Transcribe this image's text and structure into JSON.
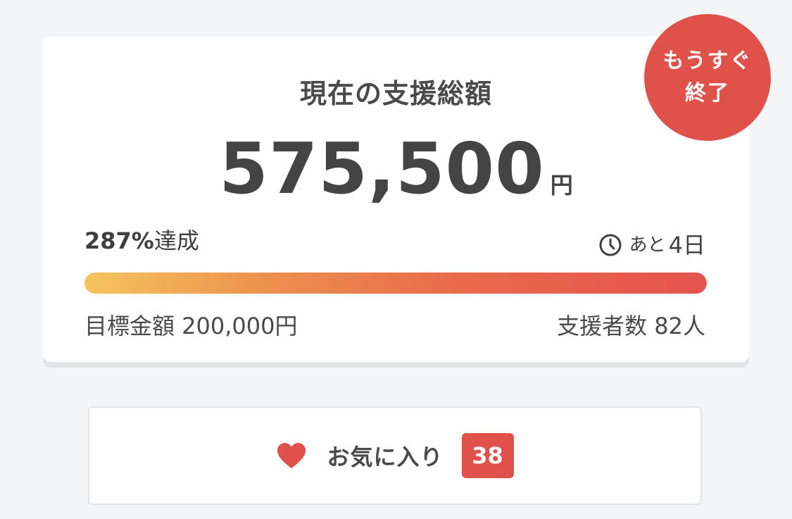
{
  "card": {
    "title": "現在の支援総額",
    "amount": "575,500",
    "amount_unit": "円",
    "achievement_percent": "287%",
    "achievement_suffix": "達成",
    "remaining_prefix": "あと",
    "remaining_value": "4日",
    "progress_fraction": 1.0,
    "goal_label": "目標金額 200,000円",
    "backers_label": "支援者数 82人",
    "badge_line1": "もうすぐ",
    "badge_line2": "終了"
  },
  "favorite": {
    "label": "お気に入り",
    "count": "38"
  },
  "colors": {
    "accent": "#e0514a",
    "progress_start": "#f5c45c",
    "progress_end": "#e5534e",
    "text": "#444444",
    "background": "#f4f5f7"
  },
  "icons": {
    "clock": "clock-icon",
    "heart": "heart-icon"
  }
}
